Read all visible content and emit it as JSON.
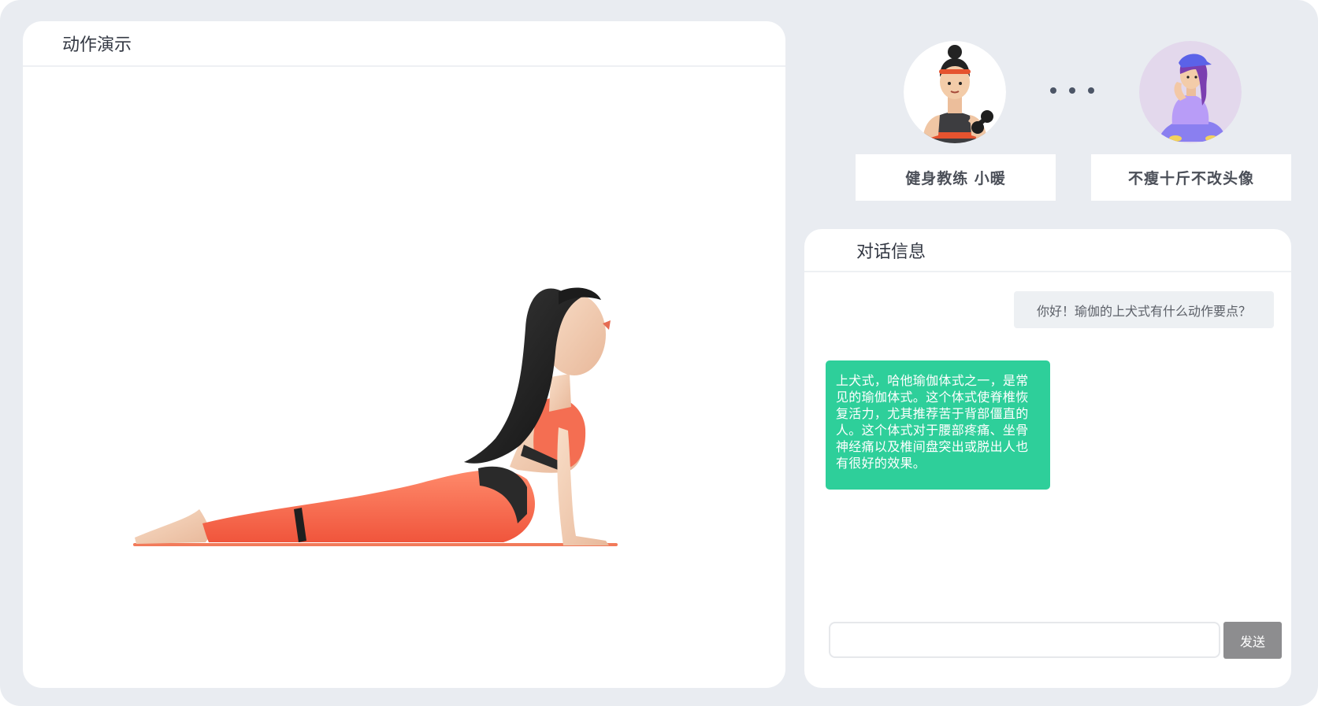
{
  "demo": {
    "title": "动作演示"
  },
  "avatars": [
    {
      "name": "健身教练 小暖",
      "icon": "fitness-coach-avatar-icon"
    },
    {
      "name": "不瘦十斤不改头像",
      "icon": "user-avatar-icon"
    }
  ],
  "chat": {
    "title": "对话信息",
    "messages": [
      {
        "role": "user",
        "text": "你好！瑜伽的上犬式有什么动作要点？"
      },
      {
        "role": "bot",
        "text": "上犬式，哈他瑜伽体式之一，是常见的瑜伽体式。这个体式使脊椎恢复活力，尤其推荐苦于背部僵直的人。这个体式对于腰部疼痛、坐骨神经痛以及椎间盘突出或脱出人也有很好的效果。"
      }
    ],
    "input_value": "",
    "send_label": "发送"
  },
  "colors": {
    "background": "#e9ecf1",
    "bot_bubble": "#2ecf9a",
    "user_bubble": "#edf0f3",
    "send_button": "#8d8d8f"
  }
}
